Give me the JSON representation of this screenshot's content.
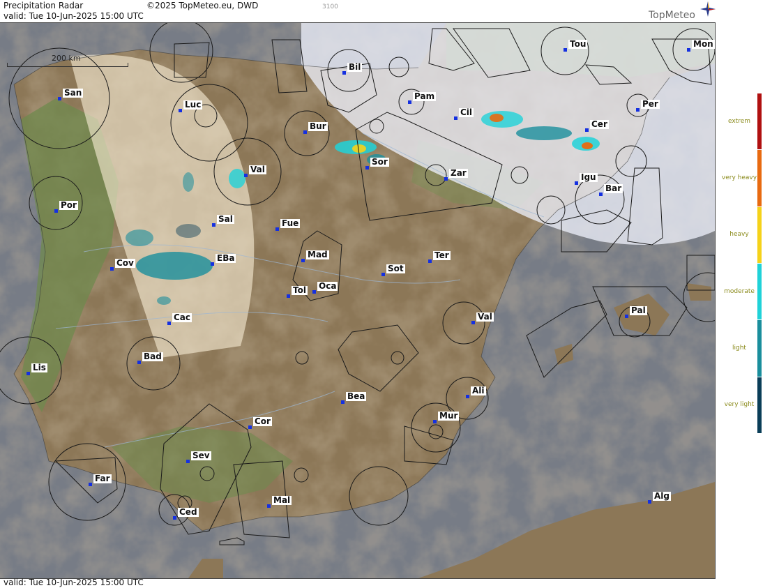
{
  "header": {
    "title": "Precipitation Radar",
    "copyright": "©2025 TopMeteo.eu, DWD",
    "code": "3100",
    "valid_top": "valid:  Tue  10-Jun-2025 15:00 UTC",
    "valid_bottom": "valid:  Tue  10-Jun-2025 15:00 UTC",
    "brand": "TopMeteo"
  },
  "map": {
    "scale_label": "200 km",
    "colors": {
      "sea": "#777c86",
      "land": "#8f7a5a",
      "radar_coverage": "#f6e9d2",
      "out_of_range": "#e3e6f5",
      "airspace_lines": "#1a1a1a",
      "city_marker": "#1530e0"
    },
    "cities": [
      {
        "id": "san",
        "label": "San"
      },
      {
        "id": "luc",
        "label": "Luc"
      },
      {
        "id": "bil",
        "label": "Bil"
      },
      {
        "id": "tou",
        "label": "Tou"
      },
      {
        "id": "mon",
        "label": "Mon"
      },
      {
        "id": "pam",
        "label": "Pam"
      },
      {
        "id": "per",
        "label": "Per"
      },
      {
        "id": "cil",
        "label": "Cil"
      },
      {
        "id": "bur",
        "label": "Bur"
      },
      {
        "id": "cer",
        "label": "Cer"
      },
      {
        "id": "val1",
        "label": "Val"
      },
      {
        "id": "sor",
        "label": "Sor"
      },
      {
        "id": "zar",
        "label": "Zar"
      },
      {
        "id": "igu",
        "label": "Igu"
      },
      {
        "id": "bar",
        "label": "Bar"
      },
      {
        "id": "por",
        "label": "Por"
      },
      {
        "id": "sal",
        "label": "Sal"
      },
      {
        "id": "fue",
        "label": "Fue"
      },
      {
        "id": "mad",
        "label": "Mad"
      },
      {
        "id": "cov",
        "label": "Cov"
      },
      {
        "id": "eba",
        "label": "EBa"
      },
      {
        "id": "ter",
        "label": "Ter"
      },
      {
        "id": "sot",
        "label": "Sot"
      },
      {
        "id": "tol",
        "label": "Tol"
      },
      {
        "id": "oca",
        "label": "Oca"
      },
      {
        "id": "pal",
        "label": "Pal"
      },
      {
        "id": "cac",
        "label": "Cac"
      },
      {
        "id": "val2",
        "label": "Val"
      },
      {
        "id": "bad",
        "label": "Bad"
      },
      {
        "id": "lis",
        "label": "Lis"
      },
      {
        "id": "ali",
        "label": "Ali"
      },
      {
        "id": "bea",
        "label": "Bea"
      },
      {
        "id": "mur",
        "label": "Mur"
      },
      {
        "id": "cor",
        "label": "Cor"
      },
      {
        "id": "sev",
        "label": "Sev"
      },
      {
        "id": "far",
        "label": "Far"
      },
      {
        "id": "mal",
        "label": "Mal"
      },
      {
        "id": "alg",
        "label": "Alg"
      },
      {
        "id": "ced",
        "label": "Ced"
      }
    ]
  },
  "legend": {
    "items": [
      {
        "label": "extrem",
        "color": "#b01010"
      },
      {
        "label": "very heavy",
        "color": "#e86a10"
      },
      {
        "label": "heavy",
        "color": "#f5d21a"
      },
      {
        "label": "moderate",
        "color": "#20d2d8"
      },
      {
        "label": "light",
        "color": "#1a8e9c"
      },
      {
        "label": "very light",
        "color": "#0a3e58"
      }
    ]
  }
}
